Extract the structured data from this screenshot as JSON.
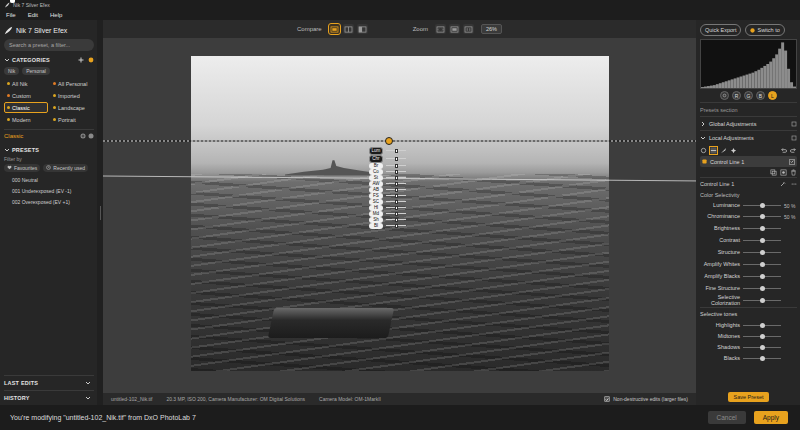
{
  "window": {
    "title": "Nik 7 Silver Efex"
  },
  "menu": [
    "File",
    "Edit",
    "Help"
  ],
  "sidebar": {
    "logo": "Nik 7 Silver Efex",
    "search": {
      "placeholder": "Search a preset, a filter..."
    },
    "categories_title": "CATEGORIES",
    "sources": [
      {
        "label": "Nik",
        "selected": false
      },
      {
        "label": "Personal",
        "selected": false
      }
    ],
    "categories": [
      {
        "label": "All Nik",
        "selected": false,
        "color": "#d9a520"
      },
      {
        "label": "All Personal",
        "selected": false,
        "color": "#e07b24"
      },
      {
        "label": "Custom",
        "selected": false,
        "color": "#e07b24"
      },
      {
        "label": "Imported",
        "selected": false,
        "color": "#d9a520"
      },
      {
        "label": "Classic",
        "selected": true,
        "color": "#d9a520"
      },
      {
        "label": "Landscape",
        "selected": false,
        "color": "#d9a520"
      },
      {
        "label": "Modern",
        "selected": false,
        "color": "#d9a520"
      },
      {
        "label": "Portrait",
        "selected": false,
        "color": "#d9a520"
      }
    ],
    "current_category": "Classic",
    "presets_title": "PRESETS",
    "filter_label": "Filter by",
    "filters": [
      {
        "label": "Favourites",
        "kind": "heart",
        "selected": false
      },
      {
        "label": "Recently used",
        "kind": "clock",
        "selected": false
      }
    ],
    "presets": [
      {
        "name": "000 Neutral"
      },
      {
        "name": "001 Underexposed (EV -1)"
      },
      {
        "name": "002 Overexposed (EV +1)"
      }
    ],
    "sections": [
      {
        "label": "LAST EDITS",
        "expanded": false
      },
      {
        "label": "HISTORY",
        "expanded": false
      }
    ]
  },
  "toolbar": {
    "compare": {
      "label": "Compare",
      "modes": [
        {
          "kind": "single",
          "selected": true
        },
        {
          "kind": "split",
          "selected": false
        },
        {
          "kind": "side",
          "selected": false
        }
      ]
    },
    "zoom": {
      "label": "Zoom",
      "tools": [
        {
          "kind": "fit",
          "selected": false
        },
        {
          "kind": "fill",
          "selected": false
        },
        {
          "kind": "actual",
          "selected": false
        }
      ],
      "value": "26%"
    }
  },
  "canvas": {
    "control_line": {
      "selected": true,
      "params": [
        {
          "label": "Lum",
          "kind": "selectivity",
          "level": 0.5
        },
        {
          "label": "Chr",
          "kind": "selectivity",
          "level": 0.5
        },
        {
          "label": "Br",
          "kind": "adjust",
          "level": 0.5
        },
        {
          "label": "Co",
          "kind": "adjust",
          "level": 0.5
        },
        {
          "label": "St",
          "kind": "adjust",
          "level": 0.5
        },
        {
          "label": "AW",
          "kind": "adjust",
          "level": 0.5
        },
        {
          "label": "AB",
          "kind": "adjust",
          "level": 0.5
        },
        {
          "label": "FS",
          "kind": "adjust",
          "level": 0.5
        },
        {
          "label": "SC",
          "kind": "adjust",
          "level": 0.5
        },
        {
          "label": "Hl",
          "kind": "adjust",
          "level": 0.5
        },
        {
          "label": "Md",
          "kind": "adjust",
          "level": 0.5
        },
        {
          "label": "Sh",
          "kind": "adjust",
          "level": 0.5
        },
        {
          "label": "Bl",
          "kind": "adjust",
          "level": 0.5
        }
      ]
    }
  },
  "status_bar": {
    "file": "untitled-102_Nik.tif",
    "info": "20.3 MP, ISO 200, Camera Manufacturer: OM Digital Solutions",
    "model": "Camera Model: OM-1MarkII",
    "option": {
      "label": "Non-destructive edits (larger files)",
      "checked": true
    }
  },
  "right": {
    "quick_export": "Quick Export",
    "switch_to": "Switch to",
    "histogram": {
      "values": [
        2,
        3,
        4,
        5,
        6,
        8,
        10,
        12,
        14,
        16,
        18,
        20,
        22,
        24,
        26,
        28,
        30,
        32,
        35,
        38,
        42,
        46,
        50,
        55,
        62,
        70,
        82,
        95,
        78,
        40,
        12,
        3
      ]
    },
    "channels": [
      {
        "label": "R",
        "selected": false
      },
      {
        "label": "G",
        "selected": false
      },
      {
        "label": "B",
        "selected": false
      },
      {
        "label": "L",
        "selected": true
      }
    ],
    "presets_section": "Presets section",
    "panels": [
      {
        "label": "Global Adjustments",
        "expanded": false
      },
      {
        "label": "Local Adjustments",
        "expanded": true
      }
    ],
    "local_items": [
      {
        "label": "Control Line 1",
        "selected": true,
        "visible": true
      }
    ],
    "detail_title": "Control Line 1",
    "color_selectivity": {
      "title": "Color Selectivity",
      "sliders": [
        {
          "label": "Luminance",
          "level": 0.5,
          "reading": "50 %"
        },
        {
          "label": "Chrominance",
          "level": 0.5,
          "reading": "50 %"
        }
      ]
    },
    "adjustments": [
      {
        "label": "Brightness",
        "level": 0.5
      },
      {
        "label": "Contrast",
        "level": 0.5
      },
      {
        "label": "Structure",
        "level": 0.5
      },
      {
        "label": "Amplify Whites",
        "level": 0.5
      },
      {
        "label": "Amplify Blacks",
        "level": 0.5
      },
      {
        "label": "Fine Structure",
        "level": 0.5
      },
      {
        "label": "Selective Colorization",
        "level": 0.5
      }
    ],
    "selective_tones": {
      "title": "Selective tones",
      "sliders": [
        {
          "label": "Highlights",
          "level": 0.5
        },
        {
          "label": "Midtones",
          "level": 0.5
        },
        {
          "label": "Shadows",
          "level": 0.5
        },
        {
          "label": "Blacks",
          "level": 0.5
        }
      ]
    },
    "save_preset": "Save Preset"
  },
  "footer": {
    "message": "You're modifying \"untitled-102_Nik.tif\" from DxO PhotoLab 7",
    "buttons": [
      {
        "label": "Cancel",
        "disabled": true,
        "primary": false
      },
      {
        "label": "Apply",
        "disabled": false,
        "primary": true
      }
    ]
  }
}
